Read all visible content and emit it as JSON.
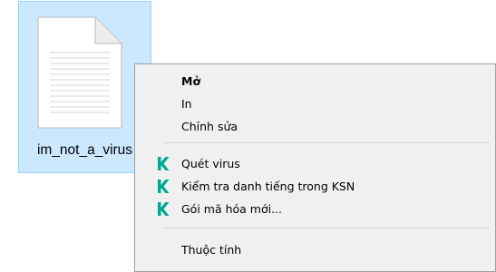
{
  "file": {
    "name": "im_not_a_virus",
    "icon": "text-document-icon"
  },
  "context_menu": {
    "items": [
      {
        "label": "Mở",
        "bold": true
      },
      {
        "label": "In"
      },
      {
        "label": "Chỉnh sửa"
      },
      {
        "label": "Quét virus",
        "icon": "kaspersky-k-icon"
      },
      {
        "label": "Kiểm tra danh tiếng trong KSN",
        "icon": "kaspersky-k-icon"
      },
      {
        "label": "Gói mã hóa mới...",
        "icon": "kaspersky-k-icon"
      },
      {
        "label": "Thuộc tính"
      }
    ]
  },
  "colors": {
    "selection_fill": "#cce8ff",
    "selection_border": "#99d1ff",
    "menu_background": "#f0f0f0",
    "kaspersky_green": "#00a88e"
  }
}
